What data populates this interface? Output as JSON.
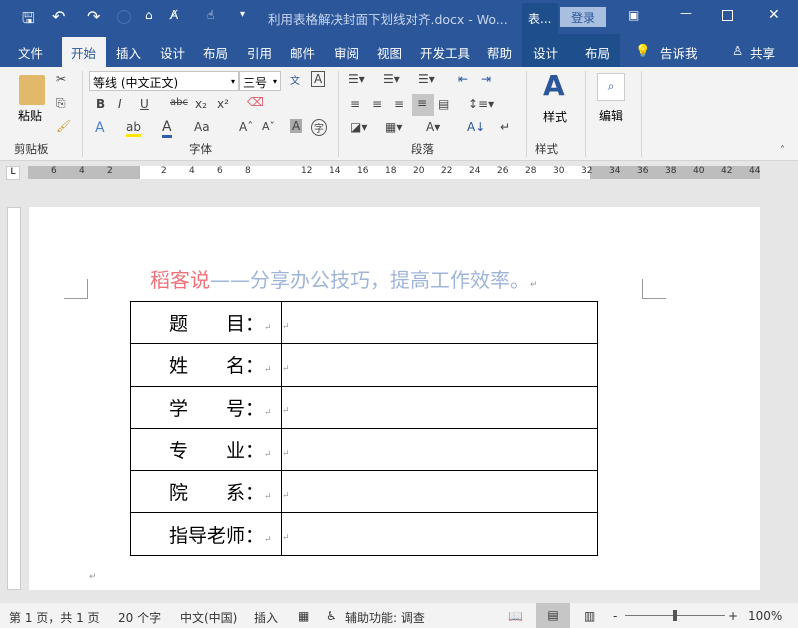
{
  "titlebar": {
    "doc_title": "利用表格解决封面下划线对齐.docx - Wo...",
    "context_label": "表...",
    "login": "登录"
  },
  "tabs": [
    "文件",
    "开始",
    "插入",
    "设计",
    "布局",
    "引用",
    "邮件",
    "审阅",
    "视图",
    "开发工具",
    "帮助",
    "设计",
    "布局"
  ],
  "tell_me": "告诉我",
  "share": "共享",
  "ribbon": {
    "paste": "粘贴",
    "clipboard": "剪贴板",
    "font_name": "等线 (中文正文)",
    "font_size": "三号",
    "font_group": "字体",
    "paragraph_group": "段落",
    "styles": "样式",
    "styles_group": "样式",
    "edit": "编辑"
  },
  "ruler": {
    "left": [
      "6",
      "4",
      "2"
    ],
    "right": [
      "2",
      "4",
      "6",
      "8",
      "12",
      "14",
      "16",
      "18",
      "20",
      "22",
      "24",
      "26",
      "28",
      "30",
      "32",
      "34",
      "36",
      "38",
      "40",
      "42",
      "44"
    ]
  },
  "doc": {
    "header_red": "稻客说",
    "header_blue": "——分享办公技巧，提高工作效率。",
    "rows": [
      [
        "题",
        "目："
      ],
      [
        "姓",
        "名："
      ],
      [
        "学",
        "号："
      ],
      [
        "专",
        "业："
      ],
      [
        "院",
        "系："
      ],
      [
        "指导老师：",
        ""
      ]
    ]
  },
  "status": {
    "page": "第 1 页，共 1 页",
    "words": "20 个字",
    "lang": "中文(中国)",
    "mode": "插入",
    "accessibility": "辅助功能: 调查",
    "zoom": "100%"
  },
  "colors": {
    "brand": "#2b579a",
    "red": "#f0717a",
    "blue": "#9fb5d8"
  }
}
